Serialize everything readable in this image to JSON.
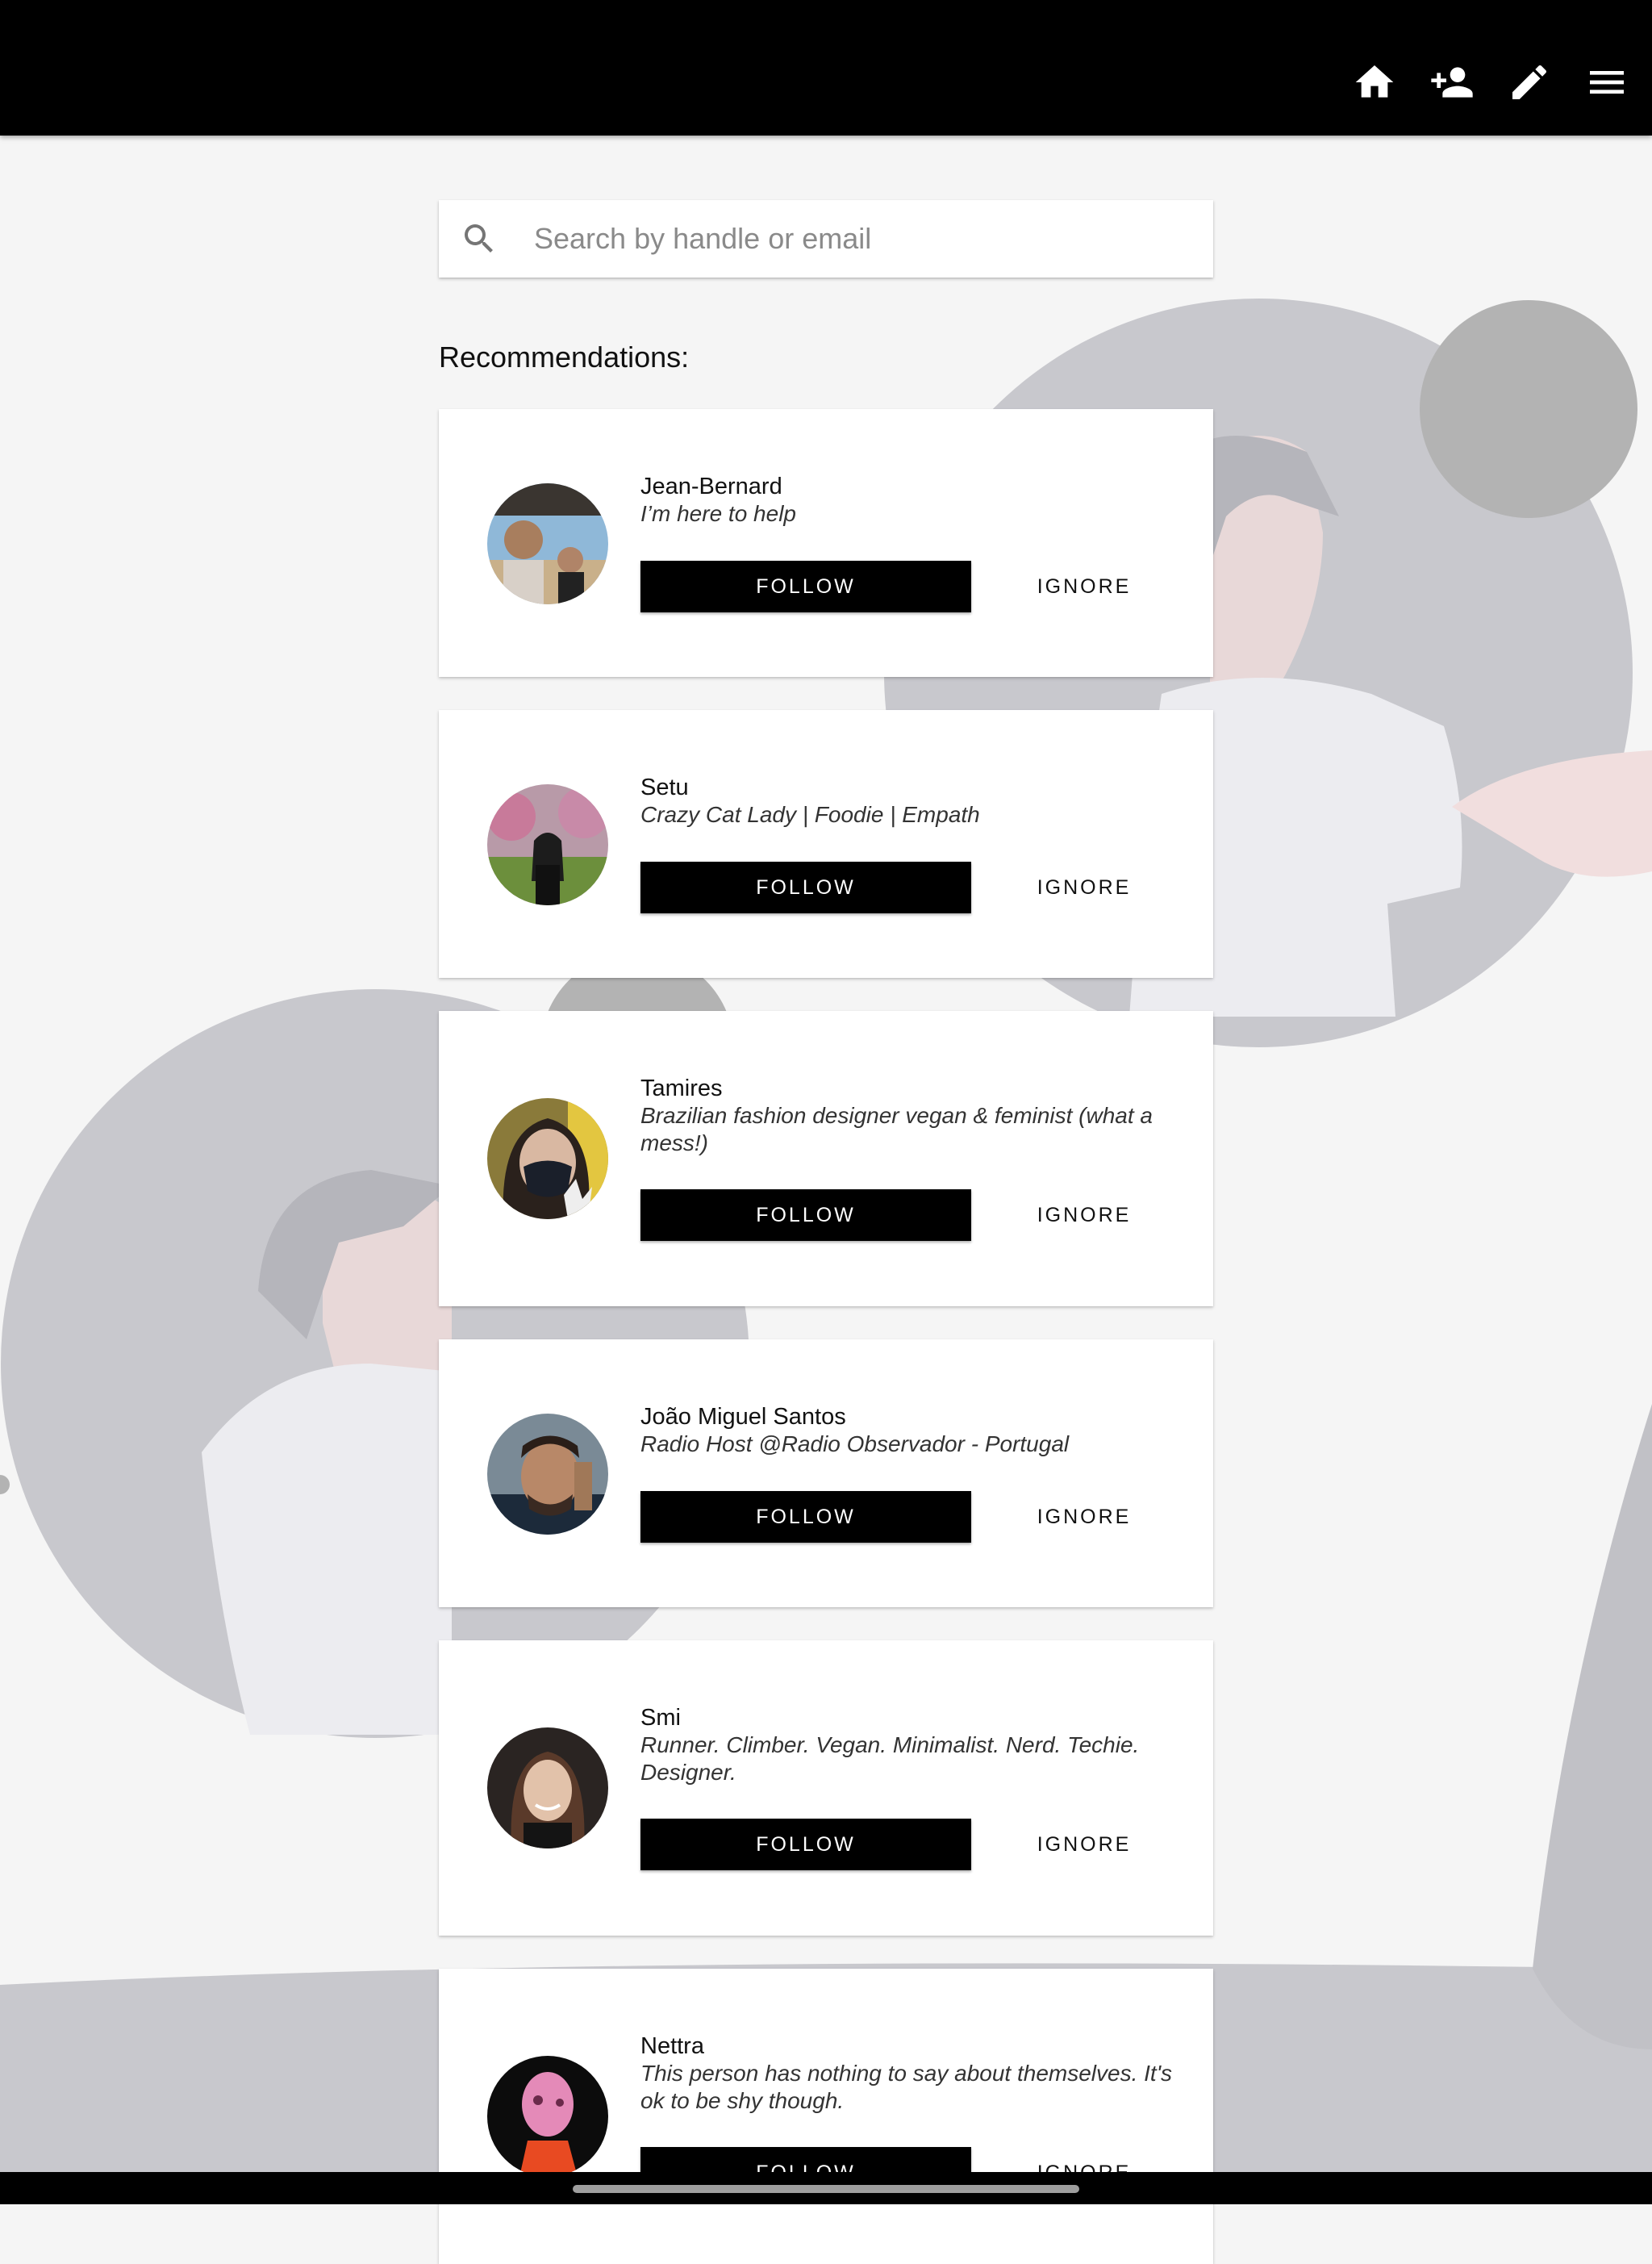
{
  "topbar": {
    "icons": [
      "home-icon",
      "person-add-icon",
      "pencil-icon",
      "menu-icon"
    ]
  },
  "search": {
    "placeholder": "Search by handle or email",
    "value": ""
  },
  "recommendations": {
    "heading": "Recommendations:",
    "items": [
      {
        "name": "Jean-Bernard",
        "bio": "I’m here to help",
        "follow_label": "FOLLOW",
        "ignore_label": "IGNORE"
      },
      {
        "name": "Setu",
        "bio": "Crazy Cat Lady | Foodie | Empath",
        "follow_label": "FOLLOW",
        "ignore_label": "IGNORE"
      },
      {
        "name": "Tamires",
        "bio": "Brazilian fashion designer vegan & feminist (what a mess!)",
        "follow_label": "FOLLOW",
        "ignore_label": "IGNORE"
      },
      {
        "name": "João Miguel Santos",
        "bio": "Radio Host @Radio Observador - Portugal",
        "follow_label": "FOLLOW",
        "ignore_label": "IGNORE"
      },
      {
        "name": "Smi",
        "bio": "Runner. Climber. Vegan. Minimalist. Nerd. Techie. Designer.",
        "follow_label": "FOLLOW",
        "ignore_label": "IGNORE"
      },
      {
        "name": "Nettra",
        "bio": "This person has nothing to say about themselves. It's ok to be shy though.",
        "follow_label": "FOLLOW",
        "ignore_label": "IGNORE"
      }
    ]
  },
  "colors": {
    "topbar": "#000000",
    "background": "#f5f5f5",
    "button": "#000000",
    "illustration": "#c8c8cd"
  }
}
